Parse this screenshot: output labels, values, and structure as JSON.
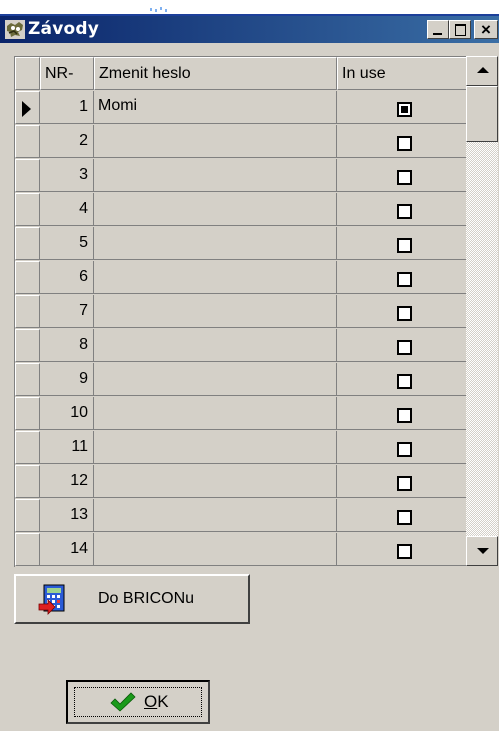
{
  "window": {
    "title": "Závody"
  },
  "title_buttons": {
    "minimize": "minimize",
    "maximize": "maximize",
    "close": "×"
  },
  "grid": {
    "columns": [
      "NR-",
      "Zmenit heslo",
      "In use"
    ],
    "rows": [
      {
        "nr": "1",
        "name": "Momi",
        "in_use": true,
        "current": true
      },
      {
        "nr": "2",
        "name": "",
        "in_use": false
      },
      {
        "nr": "3",
        "name": "",
        "in_use": false
      },
      {
        "nr": "4",
        "name": "",
        "in_use": false
      },
      {
        "nr": "5",
        "name": "",
        "in_use": false
      },
      {
        "nr": "6",
        "name": "",
        "in_use": false
      },
      {
        "nr": "7",
        "name": "",
        "in_use": false
      },
      {
        "nr": "8",
        "name": "",
        "in_use": false
      },
      {
        "nr": "9",
        "name": "",
        "in_use": false
      },
      {
        "nr": "10",
        "name": "",
        "in_use": false
      },
      {
        "nr": "11",
        "name": "",
        "in_use": false
      },
      {
        "nr": "12",
        "name": "",
        "in_use": false
      },
      {
        "nr": "13",
        "name": "",
        "in_use": false
      },
      {
        "nr": "14",
        "name": "",
        "in_use": false
      }
    ]
  },
  "buttons": {
    "briconu_label": "Do BRICONu",
    "ok_label_underlined": "O",
    "ok_label_rest": "K"
  },
  "icons": {
    "app": "app-icon",
    "briconu": "calculator-icon",
    "ok": "check-icon"
  },
  "colors": {
    "titlebar_start": "#0a246a",
    "titlebar_end": "#3a6ea5",
    "face": "#d4d0c8"
  }
}
